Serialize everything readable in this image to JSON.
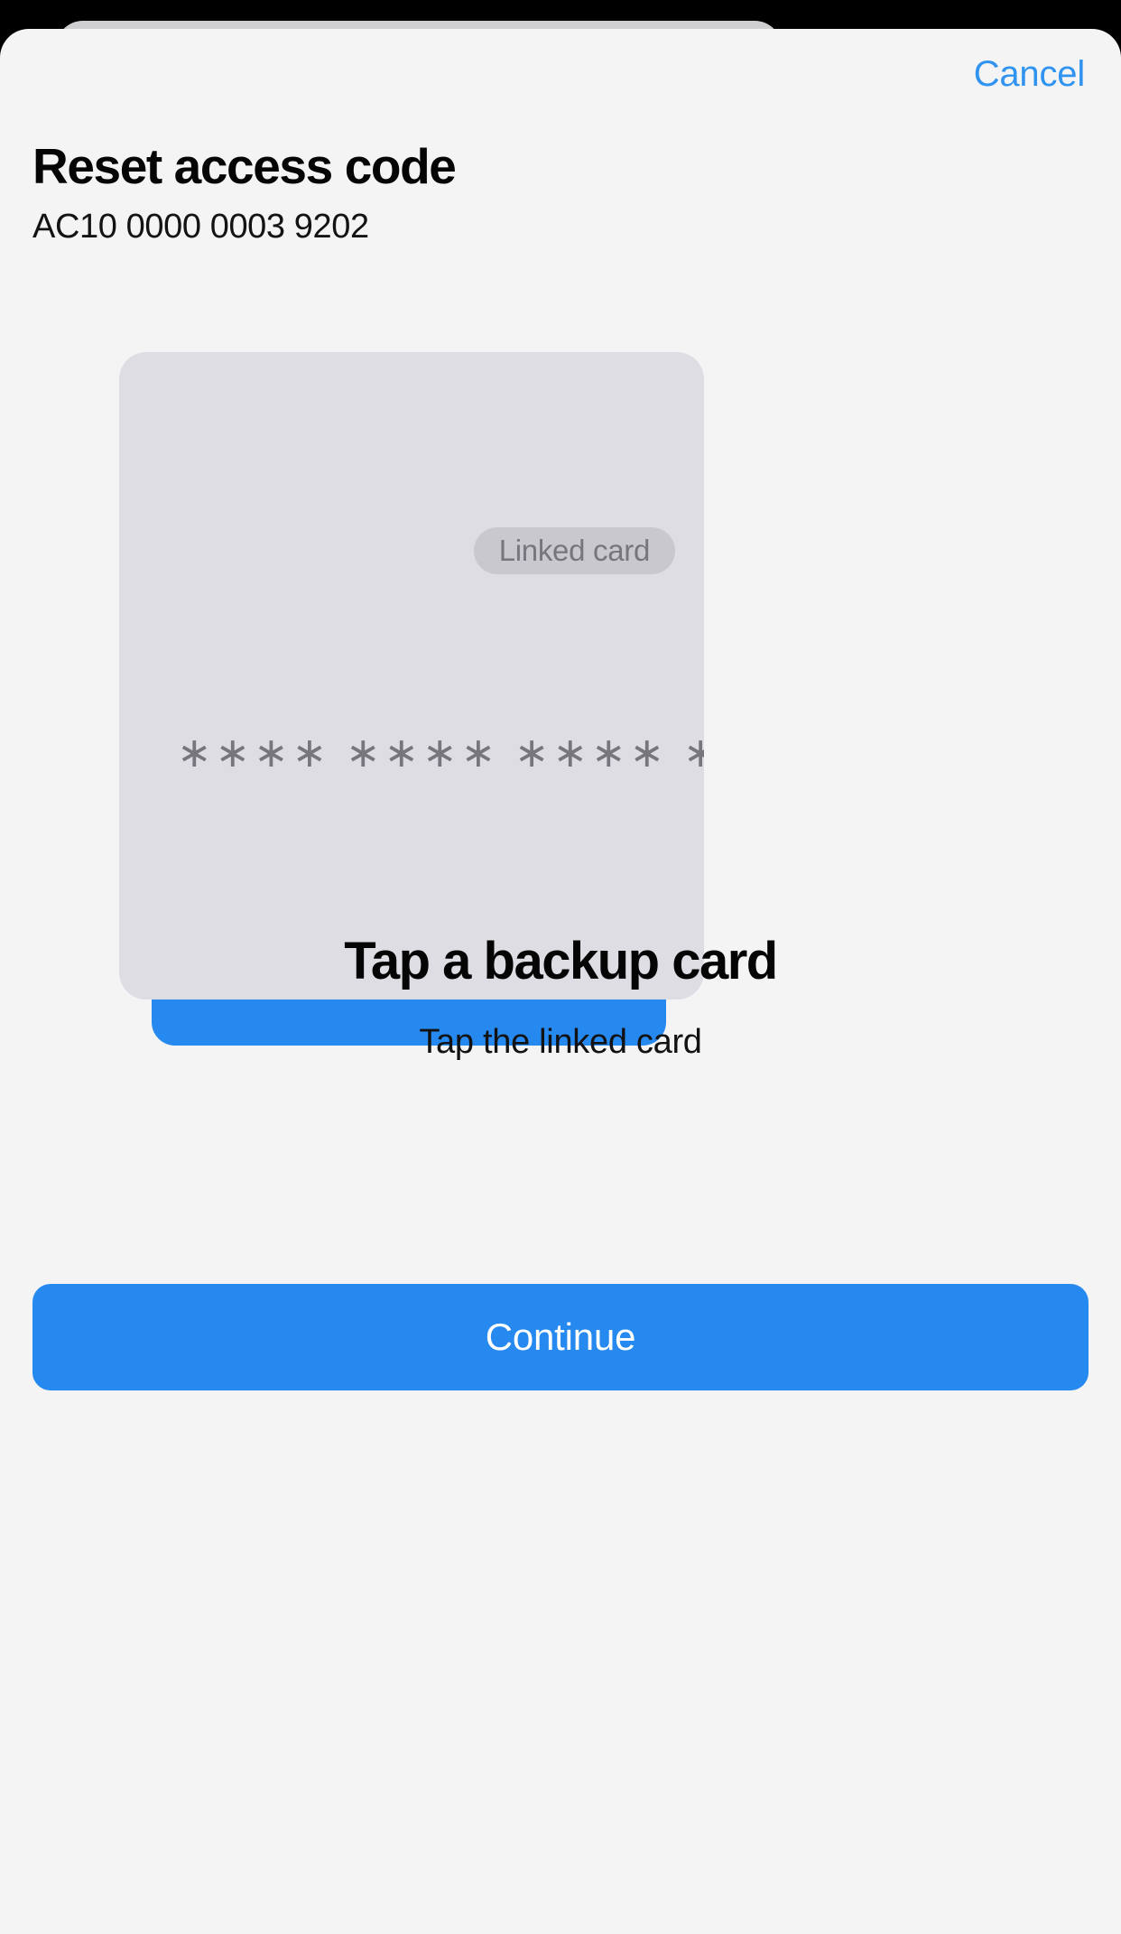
{
  "sheet": {
    "cancel_label": "Cancel",
    "title": "Reset access code",
    "subtitle": "AC10 0000 0003 9202"
  },
  "card": {
    "badge_label": "Linked card",
    "masked_number": "∗∗∗∗ ∗∗∗∗ ∗∗∗∗ ∗∗∗∗",
    "front_color": "#dedde3",
    "back_color": "#2589f0",
    "badge_color": "#c9c8ce"
  },
  "prompt": {
    "title": "Tap a backup card",
    "subtitle": "Tap the linked card"
  },
  "actions": {
    "continue_label": "Continue",
    "accent_color": "#2589f0",
    "link_color": "#2f93ef"
  }
}
